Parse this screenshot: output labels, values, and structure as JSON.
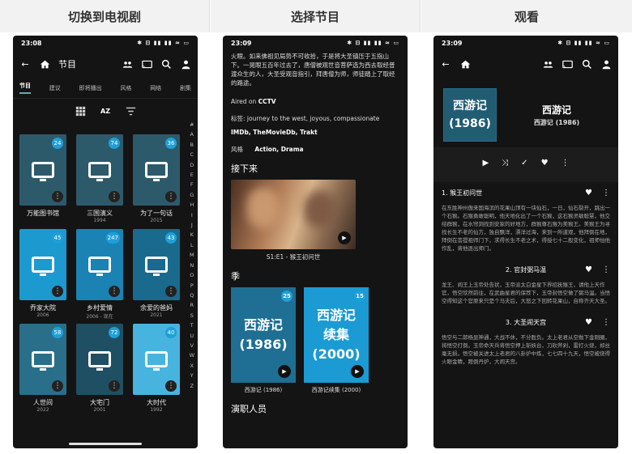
{
  "headers": [
    "切换到电视剧",
    "选择节目",
    "观看"
  ],
  "status": {
    "time1": "23:08",
    "time2": "23:09",
    "time3": "23:09",
    "indicators": "✱ ⊟ ▮▮ ▮▮ ≈ ▭"
  },
  "screen1": {
    "title": "节目",
    "tabs": [
      "节目",
      "建议",
      "即将播出",
      "风格",
      "网络",
      "剧集"
    ],
    "tool_icons": [
      "grid-icon",
      "sort-az-icon",
      "filter-icon"
    ],
    "sort_label": "AZ",
    "shows": [
      {
        "title": "万能图书馆",
        "year": "",
        "count": "24",
        "color": "#2d5a6b"
      },
      {
        "title": "三国演义",
        "year": "1994",
        "count": "74",
        "color": "#2d5a6b"
      },
      {
        "title": "为了一句话",
        "year": "2015",
        "count": "36",
        "color": "#2d5a6b"
      },
      {
        "title": "乔家大院",
        "year": "2006",
        "count": "45",
        "color": "#1c9ad0"
      },
      {
        "title": "乡村爱情",
        "year": "2006 - 现在",
        "count": "247",
        "color": "#1a83b3"
      },
      {
        "title": "余爱的爸妈",
        "year": "2021",
        "count": "43",
        "color": "#1a6a8e"
      },
      {
        "title": "人世间",
        "year": "2022",
        "count": "58",
        "color": "#2a6f8a"
      },
      {
        "title": "大宅门",
        "year": "2001",
        "count": "72",
        "color": "#1f4f63"
      },
      {
        "title": "大时代",
        "year": "1992",
        "count": "40",
        "color": "#47b4e0"
      }
    ],
    "alphabet": [
      "#",
      "A",
      "B",
      "C",
      "D",
      "E",
      "F",
      "G",
      "H",
      "I",
      "J",
      "K",
      "L",
      "M",
      "N",
      "O",
      "P",
      "Q",
      "R",
      "S",
      "T",
      "U",
      "V",
      "W",
      "X",
      "Y",
      "Z"
    ]
  },
  "screen2": {
    "synopsis": "火眼。如来佛祖见局势不可收拾，于是将大圣镇压于五指山下。一晃眼五百年过去了，唐僧被观世音菩萨选为西去取经普渡众生的人，大圣受观音指引，拜唐僧为师，师徒踏上了取经的路途。",
    "aired_label": "Aired on",
    "aired_value": "CCTV",
    "tags_label": "标签:",
    "tags_value": "journey to the west, joyous, compassionate",
    "sources": "IMDb, TheMovieDb, Trakt",
    "genre_label": "风格",
    "genre_value": "Action, Drama",
    "up_next_label": "接下来",
    "up_next_episode": "S1:E1 - 猴王初问世",
    "seasons_label": "季",
    "seasons": [
      {
        "title": "西游记\n(1986)",
        "label": "西游记 (1986)",
        "count": "25",
        "color": "#1e6f93"
      },
      {
        "title": "西游记\n续集\n(2000)",
        "label": "西游记续集 (2000)",
        "count": "15",
        "color": "#1b9ad3"
      }
    ],
    "cast_label": "演职人员"
  },
  "screen3": {
    "poster_title": "西游记\n(1986)",
    "title": "西游记",
    "subtitle": "西游记 (1986)",
    "episodes": [
      {
        "title": "1. 猴王初问世",
        "desc": "在东胜神州傲来国海滨的花果山顶有一块仙石，一日，仙石裂开，跳出一个石猴。石猴勇敢聪明，他天地化出了一个石猴，这石猴灵敏聪慧，他交结群猴，在水帘洞找到安家的好地方，群猴尊石猴为美猴王。美猴王为寻找长生不老的仙方，独自飘洋，漂洋过海，来到一所道观，他拜倒在地，拜倒在菩提祖师门下，求得长生不老之术，得授七十二般变化，祖师怕他作乱，将他逐出师门。"
      },
      {
        "title": "2. 官封弼马温",
        "desc": "龙王、阎王上玉帝处告状，玉帝派太白金星下界招抚猴王，请他上天作官，悟空欣然前往，在武曲星君的保荐下，玉帝封悟空做了弼马温。当悟空得知这个官原来只是个马夫后，大怒之下回转花果山，自称齐天大圣。"
      },
      {
        "title": "3. 大圣闹天宫",
        "desc": "悟空与二郎杨显神通，大战不休，不分胜负。太上老君从空抛下金刚圈，将悟空打倒。玉帝命天兵将悟空押上斩妖台，刀砍斧剁，雷打火烧，却丝毫无损。悟空被关进太上老君的八卦炉中炼，七七四十九天，悟空被烧得火眼金睛，蹬倒丹炉，大闹天宫。"
      }
    ]
  }
}
